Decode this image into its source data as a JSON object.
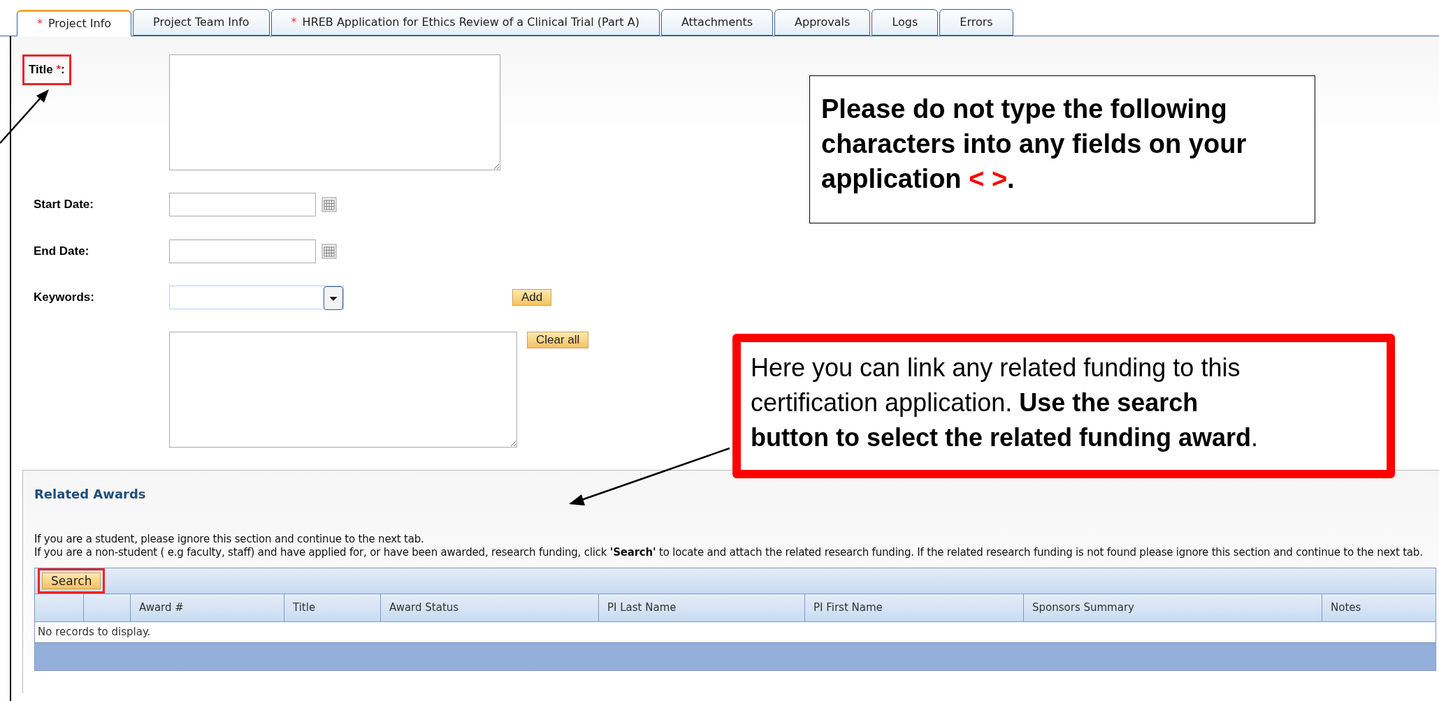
{
  "tabs": [
    {
      "label": "Project Info",
      "required_mark": "*",
      "selected": true
    },
    {
      "label": "Project Team Info",
      "selected": false
    },
    {
      "label": "HREB Application for Ethics Review of a Clinical Trial (Part A)",
      "required_mark": "*",
      "selected": false
    },
    {
      "label": "Attachments",
      "selected": false
    },
    {
      "label": "Approvals",
      "selected": false
    },
    {
      "label": "Logs",
      "selected": false
    },
    {
      "label": "Errors",
      "selected": false
    }
  ],
  "form": {
    "title": {
      "label": "Title",
      "required_mark": "*",
      "colon": ":",
      "highlighted": true
    },
    "start_date": {
      "label": "Start Date:"
    },
    "end_date": {
      "label": "End Date:"
    },
    "keywords": {
      "label": "Keywords:",
      "add_button": "Add",
      "clear_button": "Clear all"
    }
  },
  "notes": [
    {
      "kind": "warning",
      "text": "Please do not type the following characters into any fields on your application",
      "emphasis": "< >",
      "tail": "."
    },
    {
      "kind": "callout",
      "text": "Here you can link any related funding to this certification application. **Use the search button to select the related funding award**."
    }
  ],
  "related_awards": {
    "title": "Related Awards",
    "lines": [
      "If you are a student, please ignore this section and continue to the next tab.",
      "If you are a non-student ( e.g faculty, staff) and have applied for, or have been awarded, research funding, click **'Search'** to locate and attach the related research funding. If the related research funding is not found please ignore this section and continue to the next tab."
    ],
    "search_button": {
      "label": "Search",
      "highlighted": true
    },
    "table": {
      "columns": [
        "Award #",
        "Title",
        "Award Status",
        "PI Last Name",
        "PI First Name",
        "Sponsors Summary",
        "Notes"
      ],
      "empty_text": "No records to display."
    }
  }
}
